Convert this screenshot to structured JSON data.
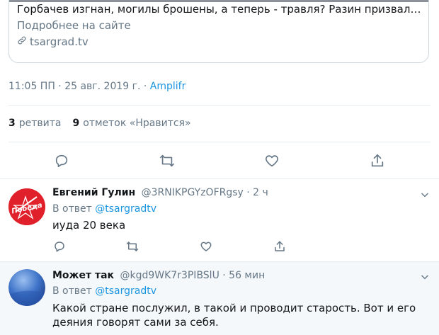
{
  "card": {
    "title": "Горбачев изгнан, могилы брошены, а теперь - травля? Разин призвал Росс…",
    "description": "Подробнее на сайте",
    "domain": "tsargrad.tv"
  },
  "tweet_meta": {
    "time": "11:05 ПП · 25 авг. 2019 г. · ",
    "source": "Amplifr"
  },
  "stats": {
    "retweets_count": "3",
    "retweets_label": "ретвита",
    "likes_count": "9",
    "likes_label": "отметок «Нравится»"
  },
  "replies": [
    {
      "name": "Евгений Гулин",
      "handle": "@3RNIKPGYzOFRgsy · 2 ч",
      "reply_prefix": "В ответ ",
      "reply_to": "@tsargradtv",
      "text": "иуда 20 века",
      "avatar_text": "Победа"
    },
    {
      "name": "Может так",
      "handle": "@kgd9WK7r3PIBSlU · 56 мин",
      "reply_prefix": "В ответ ",
      "reply_to": "@tsargradtv",
      "text": "Какой стране послужил, в такой и проводит старость. Вот и его деяния говорят сами за себя."
    }
  ],
  "colors": {
    "accent": "#1b95e0",
    "secondary": "#657786",
    "highlight_bg": "#f5f8fa",
    "avatar1_bg": "#e0202a"
  },
  "icons": [
    "link-icon",
    "reply-icon",
    "retweet-icon",
    "like-icon",
    "share-icon",
    "chevron-down-icon"
  ]
}
